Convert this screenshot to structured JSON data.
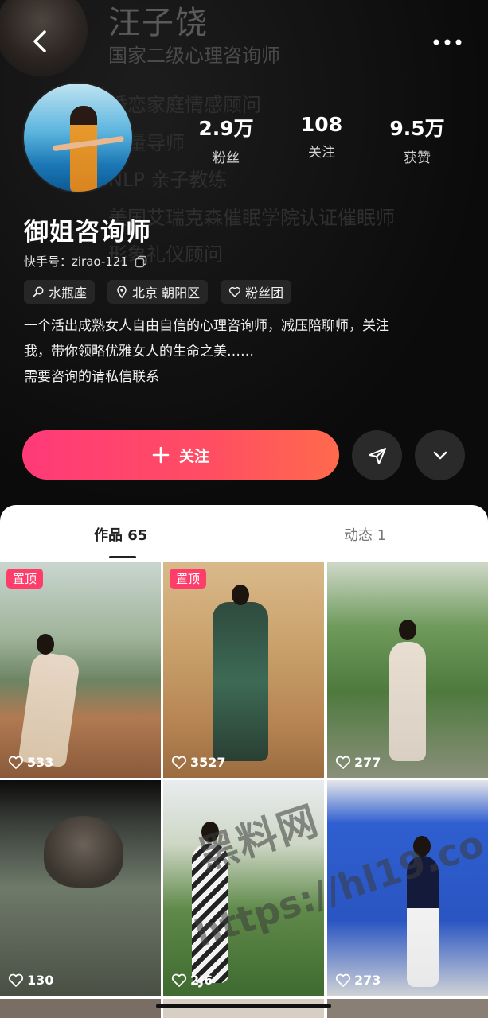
{
  "background": {
    "name": "汪子饶",
    "subtitle": "国家二级心理咨询师",
    "lines": [
      "婚恋家庭情感顾问",
      "能量导师",
      "NLP 亲子教练",
      "美国艾瑞克森催眠学院认证催眠师",
      "形象礼仪顾问"
    ]
  },
  "profile": {
    "title": "御姐咨询师",
    "kuaishou_id": "快手号：zirao-121",
    "tags": [
      {
        "icon": "search-icon",
        "label": "水瓶座"
      },
      {
        "icon": "location-icon",
        "label": "北京 朝阳区"
      },
      {
        "icon": "heart-outline-icon",
        "label": "粉丝团"
      }
    ],
    "bio_line1": "一个活出成熟女人自由自信的心理咨询师，减压陪聊师，关注",
    "bio_line2": "我，带你领略优雅女人的生命之美……",
    "bio_line3": "需要咨询的请私信联系"
  },
  "stats": [
    {
      "value": "2.9万",
      "label": "粉丝"
    },
    {
      "value": "108",
      "label": "关注"
    },
    {
      "value": "9.5万",
      "label": "获赞"
    }
  ],
  "actions": {
    "follow_label": "关注"
  },
  "tabs": {
    "works": "作品 65",
    "dynamic": "动态 1"
  },
  "grid": [
    {
      "pinned": true,
      "pin_label": "置顶",
      "likes": "533"
    },
    {
      "pinned": true,
      "pin_label": "置顶",
      "likes": "3527"
    },
    {
      "pinned": false,
      "likes": "277"
    },
    {
      "pinned": false,
      "likes": "130"
    },
    {
      "pinned": false,
      "likes": "2J6"
    },
    {
      "pinned": false,
      "likes": "273"
    }
  ],
  "watermark": {
    "line1": "黑料网",
    "line2": "https://hl19.co"
  },
  "colors": {
    "accent": "#ff4e62",
    "background": "#0b0b0b",
    "sheet": "#ffffff"
  }
}
